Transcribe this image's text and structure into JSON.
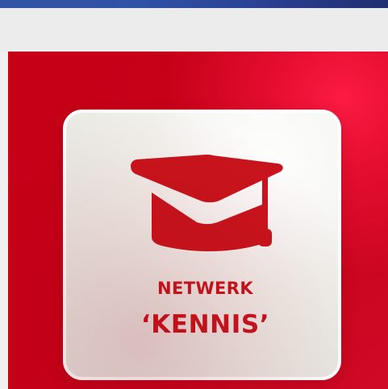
{
  "title": {
    "line1": "NETWERK",
    "line2": "‘KENNIS’"
  },
  "icon": {
    "name": "graduation-cap-icon"
  },
  "colors": {
    "blue_bar": "#2f52a7",
    "red_background": "#c50017",
    "highlight_red": "#ff1c46",
    "tile_background": "#ebebe6",
    "text_red": "#c8141d",
    "white": "#ffffff"
  }
}
